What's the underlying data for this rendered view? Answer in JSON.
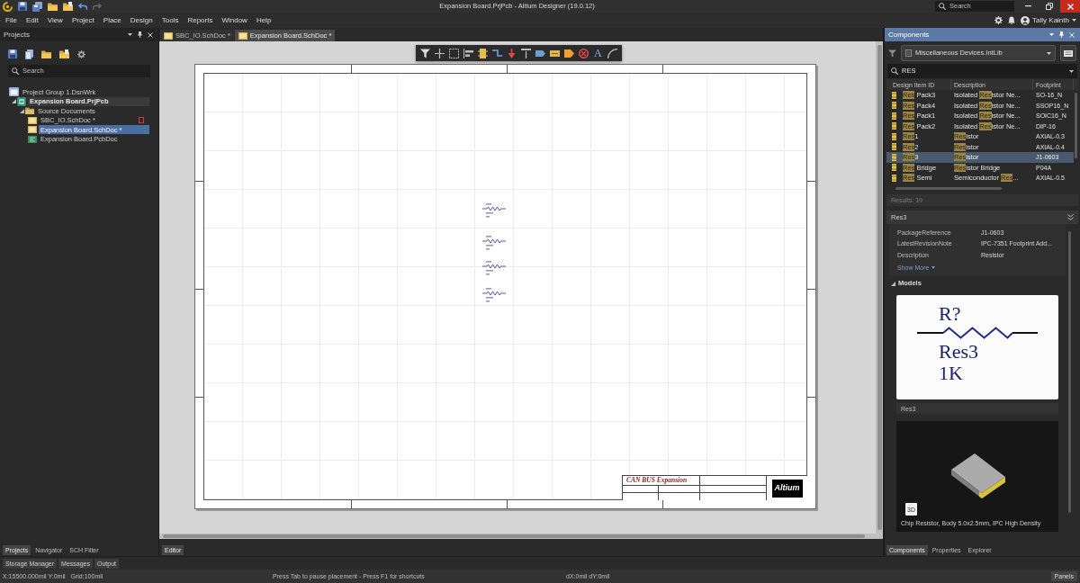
{
  "window": {
    "title": "Expansion Board.PrjPcb - Altium Designer (19.0.12)",
    "search": {
      "placeholder": "Search"
    }
  },
  "menu": [
    "File",
    "Edit",
    "View",
    "Project",
    "Place",
    "Design",
    "Tools",
    "Reports",
    "Window",
    "Help"
  ],
  "user": {
    "name": "Tally Kainth"
  },
  "projects_panel": {
    "title": "Projects",
    "search": {
      "placeholder": "Search"
    },
    "tree": [
      {
        "label": "Project Group 1.DsnWrk",
        "kind": "workspace",
        "selected": false,
        "focused": false,
        "children": [
          {
            "label": "Expansion Board.PrjPcb",
            "kind": "pcb_project",
            "selected": false,
            "focused": true,
            "expanded": true,
            "children": [
              {
                "label": "Source Documents",
                "kind": "folder",
                "selected": false,
                "focused": false,
                "expanded": true,
                "children": [
                  {
                    "label": "SBC_IO.SchDoc *",
                    "kind": "schematic",
                    "selected": false,
                    "focused": false,
                    "red_mark": true
                  },
                  {
                    "label": "Expansion Board.SchDoc *",
                    "kind": "schematic",
                    "selected": true,
                    "focused": false,
                    "red_mark": false
                  },
                  {
                    "label": "Expansion Board.PcbDoc",
                    "kind": "pcb",
                    "selected": false,
                    "focused": false,
                    "red_mark": false
                  }
                ]
              }
            ]
          }
        ]
      }
    ],
    "tabs": [
      {
        "label": "Projects",
        "selected": true
      },
      {
        "label": "Navigator",
        "selected": false
      },
      {
        "label": "SCH Filter",
        "selected": false
      }
    ]
  },
  "editor": {
    "tabs": [
      {
        "label": "SBC_IO.SchDoc *",
        "selected": false
      },
      {
        "label": "Expansion Board.SchDoc *",
        "selected": true
      }
    ],
    "toolbar_text_tool": "A",
    "sheet": {
      "title": "CAN BUS Expansion",
      "logo": "Altium"
    },
    "bottom_tabs": [
      {
        "label": "Editor",
        "selected": true
      }
    ]
  },
  "components_panel": {
    "title": "Components",
    "library": "Miscellaneous Devices.IntLib",
    "search": {
      "value": "RES"
    },
    "columns": [
      "Design Item ID",
      "Description",
      "Footprint"
    ],
    "rows": [
      {
        "selected": false,
        "id": {
          "match": "Res",
          "after": " Pack3"
        },
        "description": {
          "before": "Isolated ",
          "match": "Res",
          "after": "istor Ne..."
        },
        "footprint": "SO-16_N"
      },
      {
        "selected": false,
        "id": {
          "match": "Res",
          "after": " Pack4"
        },
        "description": {
          "before": "Isolated ",
          "match": "Res",
          "after": "istor Ne..."
        },
        "footprint": "SSOP16_N"
      },
      {
        "selected": false,
        "id": {
          "match": "Res",
          "after": " Pack1"
        },
        "description": {
          "before": "Isolated ",
          "match": "Res",
          "after": "istor Ne..."
        },
        "footprint": "SOIC16_N"
      },
      {
        "selected": false,
        "id": {
          "match": "Res",
          "after": " Pack2"
        },
        "description": {
          "before": "Isolated ",
          "match": "Res",
          "after": "istor Ne..."
        },
        "footprint": "DIP-16"
      },
      {
        "selected": false,
        "id": {
          "match": "Res",
          "after": "1"
        },
        "description": {
          "match": "Res",
          "after": "istor"
        },
        "footprint": "AXIAL-0.3"
      },
      {
        "selected": false,
        "id": {
          "match": "Res",
          "after": "2"
        },
        "description": {
          "match": "Res",
          "after": "istor"
        },
        "footprint": "AXIAL-0.4"
      },
      {
        "selected": true,
        "id": {
          "match": "Res",
          "after": "3"
        },
        "description": {
          "match": "Res",
          "after": "istor"
        },
        "footprint": "J1-0603"
      },
      {
        "selected": false,
        "id": {
          "match": "Res",
          "after": " Bridge"
        },
        "description": {
          "match": "Res",
          "after": "istor Bridge"
        },
        "footprint": "P04A"
      },
      {
        "selected": false,
        "id": {
          "match": "Res",
          "after": " Semi"
        },
        "description": {
          "before": "Semiconductor ",
          "match": "Res",
          "after": "..."
        },
        "footprint": "AXIAL-0.5"
      }
    ],
    "results": "Results: 19",
    "details": {
      "title": "Res3",
      "properties": [
        {
          "name": "PackageReference",
          "value": "J1-0603"
        },
        {
          "name": "LatestRevisionNote",
          "value": "IPC-7351 Footprint Add..."
        },
        {
          "name": "Description",
          "value": "Resistor"
        }
      ],
      "show_more": "Show More",
      "models": {
        "title": "Models",
        "expanded": true,
        "symbol": {
          "designator": "R?",
          "comment": "Res3",
          "value": "1K"
        },
        "symbol_name": "Res3",
        "view_button": "3D",
        "footprint_caption": "Chip Resistor, Body 5.0x2.5mm, IPC High Density"
      }
    },
    "tabs": [
      {
        "label": "Components",
        "selected": true
      },
      {
        "label": "Properties",
        "selected": false
      },
      {
        "label": "Explorer",
        "selected": false
      }
    ]
  },
  "panel_buttons": [
    "Storage Manager",
    "Messages",
    "Output"
  ],
  "status_bar": {
    "position": "X:15500.000mil Y:0mil",
    "grid": "Grid:100mil",
    "hint": "Press Tab to pause placement - Press F1 for shortcuts",
    "delta": "dX:0mil dY:0mil",
    "panels_button": "Panels"
  }
}
